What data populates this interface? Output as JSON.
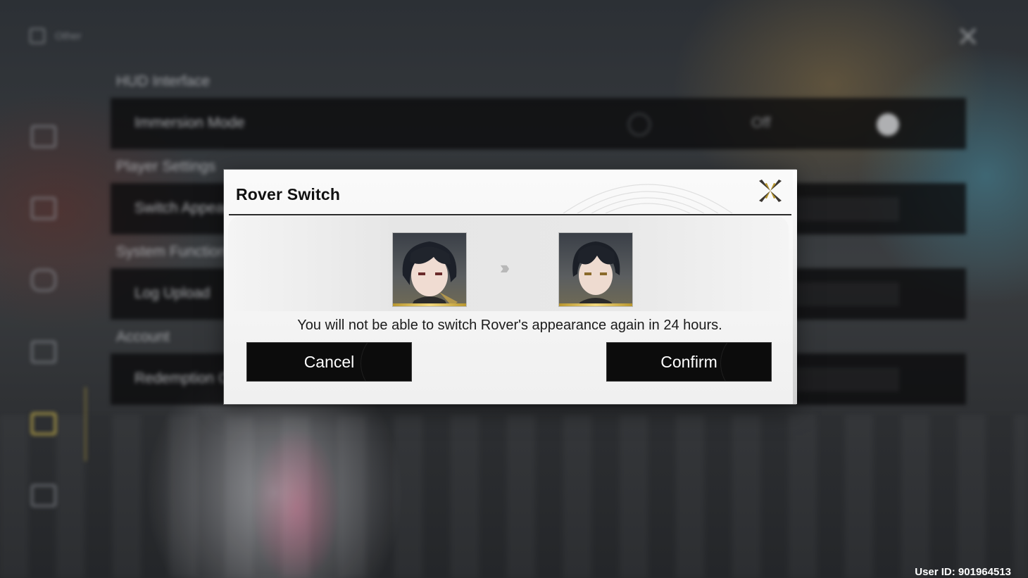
{
  "background": {
    "sidebar": {
      "top_label": "Other",
      "icons": [
        "user-icon",
        "display-icon",
        "chat-icon",
        "gamepad-icon",
        "keyboard-icon",
        "settings-icon",
        "account-icon"
      ]
    },
    "sections": {
      "hud": "HUD Interface",
      "player": "Player Settings",
      "system": "System Functions",
      "account": "Account"
    },
    "rows": {
      "immersion_label": "Immersion Mode",
      "immersion_value": "Off",
      "switch_label": "Switch Appearance",
      "log_label": "Log Upload",
      "redeem_label": "Redemption Code"
    }
  },
  "dialog": {
    "title": "Rover Switch",
    "message": "You will not be able to switch Rover's appearance again in 24 hours.",
    "cancel_label": "Cancel",
    "confirm_label": "Confirm",
    "arrows": "›››",
    "from_portrait": "female-rover",
    "to_portrait": "male-rover"
  },
  "footer": {
    "user_id": "User ID: 901964513"
  },
  "colors": {
    "accent_gold": "#c9b24a",
    "button_bg": "#0c0c0c",
    "dialog_bg": "#f4f4f4"
  }
}
